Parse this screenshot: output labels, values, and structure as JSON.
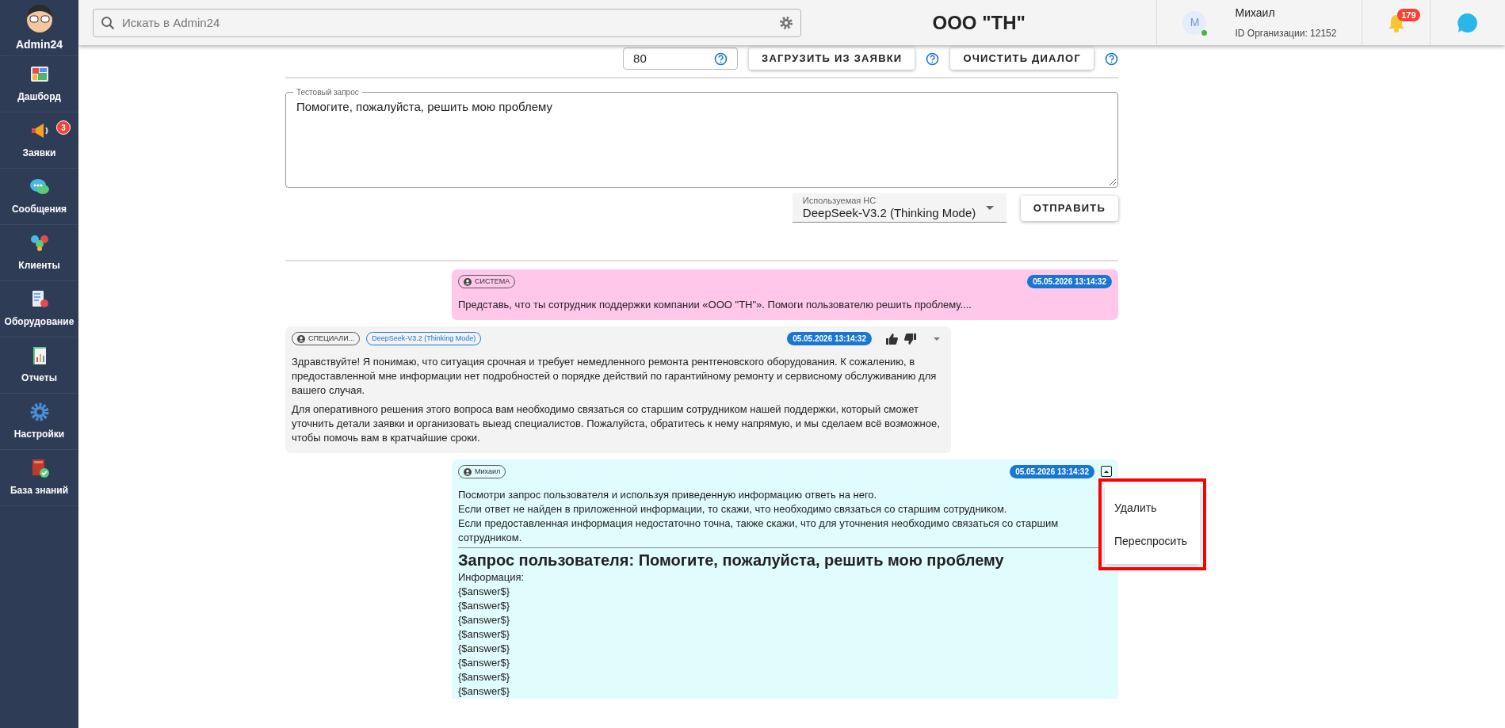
{
  "sidebar": {
    "brand": "Admin24",
    "items": [
      {
        "label": "Дашборд"
      },
      {
        "label": "Заявки",
        "badge": "3"
      },
      {
        "label": "Сообщения"
      },
      {
        "label": "Клиенты"
      },
      {
        "label": "Оборудование"
      },
      {
        "label": "Отчеты"
      },
      {
        "label": "Настройки"
      },
      {
        "label": "База знаний"
      }
    ]
  },
  "header": {
    "search": {
      "placeholder": "Искать в Admin24"
    },
    "org_title": "ООО \"ТН\"",
    "user": {
      "initial": "M",
      "name": "Михаил",
      "org_id": "ID Организации: 12152",
      "online": true
    },
    "notifications": "179"
  },
  "toolbar": {
    "limit_value": "80",
    "buttons": [
      "ЗАГРУЗИТЬ ИЗ ЗАЯВКИ",
      "ОЧИСТИТЬ ДИАЛОГ"
    ]
  },
  "test_request": {
    "label": "Тестовый запрос",
    "value": "Помогите, пожалуйста, решить мою проблему"
  },
  "model_select": {
    "label": "Используемая НС",
    "value": "DeepSeek-V3.2 (Thinking Mode)"
  },
  "send_button": "ОТПРАВИТЬ",
  "messages": [
    {
      "kind": "system",
      "author": "СИСТЕМА",
      "time": "05.05.2026 13:14:32",
      "paragraphs": [
        "Представь, что ты сотрудник поддержки компании «ООО \"ТН\"». Помоги пользователю решить проблему...."
      ]
    },
    {
      "kind": "assistant",
      "author": "СПЕЦИАЛИ...",
      "model": "DeepSeek-V3.2 (Thinking Mode)",
      "time": "05.05.2026 13:14:32",
      "paragraphs": [
        "Здравствуйте! Я понимаю, что ситуация срочная и требует немедленного ремонта рентгеновского оборудования. К сожалению, в предоставленной мне информации нет подробностей о порядке действий по гарантийному ремонту и сервисному обслуживанию для вашего случая.",
        "Для оперативного решения этого вопроса вам необходимо связаться со старшим сотрудником нашей поддержки, который сможет уточнить детали заявки и организовать выезд специалистов. Пожалуйста, обратитесь к нему напрямую, и мы сделаем всё возможное, чтобы помочь вам в кратчайшие сроки."
      ]
    },
    {
      "kind": "user",
      "author": "Михаил",
      "time": "05.05.2026 13:14:32",
      "menu_open": true,
      "lines": [
        "Посмотри запрос пользователя и используя приведенную информацию ответь на него.",
        "Если ответ не найден в приложенной информации, то скажи, что необходимо связаться со старшим сотрудником.",
        "Если предоставленная информация недостаточно точна, также скажи, что для уточнения необходимо связаться со старшим сотрудником."
      ],
      "heading": "Запрос пользователя: Помогите, пожалуйста, решить мою проблему",
      "info_label": "Информация:",
      "info_lines": [
        "{$answer$}",
        "{$answer$}",
        "{$answer$}",
        "{$answer$}",
        "{$answer$}",
        "{$answer$}",
        "{$answer$}",
        "{$answer$}"
      ]
    }
  ],
  "context_menu": [
    "Удалить",
    "Переспросить"
  ]
}
